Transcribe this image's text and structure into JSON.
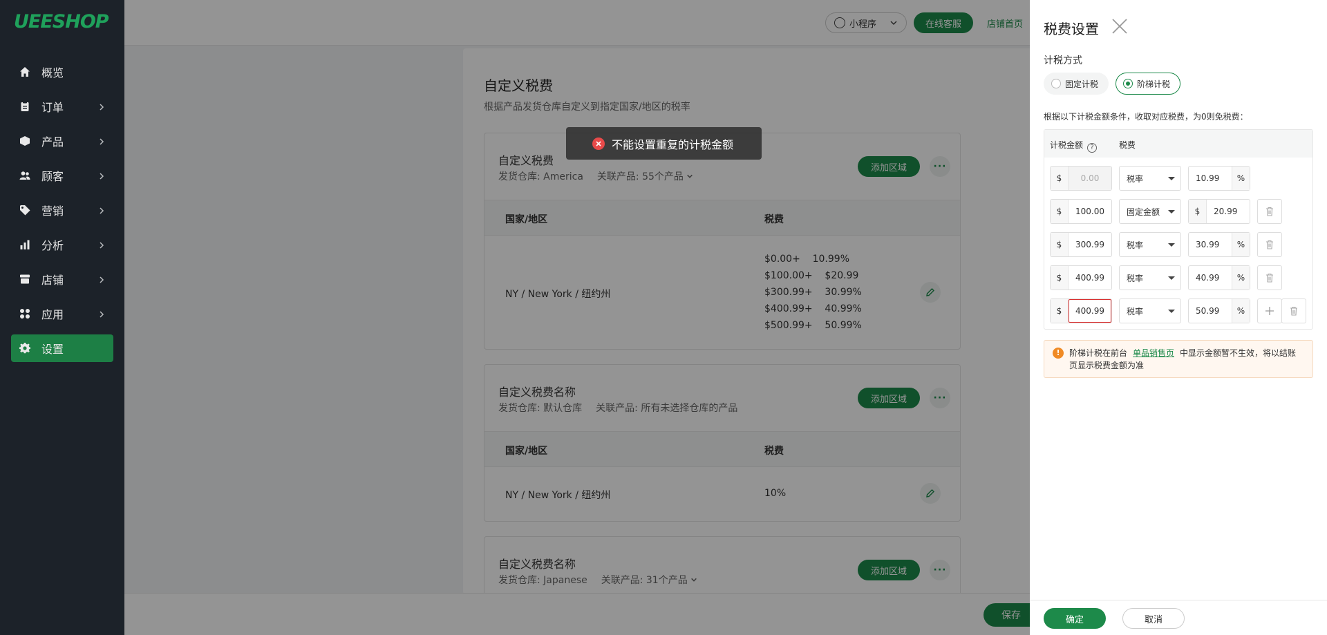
{
  "brand": {
    "logo": "UEESHOP"
  },
  "sidebar": {
    "items": [
      {
        "label": "概览",
        "icon": "home-icon"
      },
      {
        "label": "订单",
        "icon": "clipboard-icon"
      },
      {
        "label": "产品",
        "icon": "box-icon"
      },
      {
        "label": "顾客",
        "icon": "users-icon"
      },
      {
        "label": "营销",
        "icon": "tag-icon"
      },
      {
        "label": "分析",
        "icon": "bar-chart-icon"
      },
      {
        "label": "店铺",
        "icon": "store-icon"
      },
      {
        "label": "应用",
        "icon": "apps-icon"
      },
      {
        "label": "设置",
        "icon": "gear-icon"
      }
    ],
    "active_index": 8
  },
  "topbar": {
    "mini_program": "小程序",
    "service": "在线客服",
    "shop_home": "店铺首页"
  },
  "page": {
    "title": "自定义税费",
    "subtitle": "根据产品发货仓库自定义到指定国家/地区的税率",
    "add_label": "添加"
  },
  "tax_blocks": [
    {
      "title": "自定义税费",
      "warehouse": "发货仓库: America",
      "products": "关联产品: 55个产品",
      "add_region": "添加区域",
      "col_region": "国家/地区",
      "col_tax": "税费",
      "region": "NY / New York / 纽约州",
      "rates": [
        "$0.00+    10.99%",
        "$100.00+    $20.99",
        "$300.99+    30.99%",
        "$400.99+    40.99%",
        "$500.99+    50.99%"
      ]
    },
    {
      "title": "自定义税费名称",
      "warehouse": "发货仓库: 默认仓库",
      "products": "关联产品: 所有未选择仓库的产品",
      "add_region": "添加区域",
      "col_region": "国家/地区",
      "col_tax": "税费",
      "region": "NY / New York / 纽约州",
      "rates": [
        "10%"
      ]
    },
    {
      "title": "自定义税费名称",
      "warehouse": "发货仓库: Japanese",
      "products": "关联产品: 31个产品",
      "add_region": "添加区域"
    }
  ],
  "bottom_bar": {
    "save": "保存"
  },
  "toast": {
    "message": "不能设置重复的计税金额"
  },
  "drawer": {
    "title": "税费设置",
    "method_label": "计税方式",
    "method_options": [
      "固定计税",
      "阶梯计税"
    ],
    "method_selected": "阶梯计税",
    "description": "根据以下计税金额条件，收取对应税费，为0则免税费：",
    "col_amount": "计税金额",
    "col_tax": "税费",
    "currency": "$",
    "percent": "%",
    "tiers": [
      {
        "amount": "0.00",
        "type": "税率",
        "value": "10.99",
        "unit": "%",
        "disabled": true
      },
      {
        "amount": "100.00",
        "type": "固定金额",
        "value": "20.99",
        "unit": "$"
      },
      {
        "amount": "300.99",
        "type": "税率",
        "value": "30.99",
        "unit": "%"
      },
      {
        "amount": "400.99",
        "type": "税率",
        "value": "40.99",
        "unit": "%"
      },
      {
        "amount": "400.99",
        "type": "税率",
        "value": "50.99",
        "unit": "%",
        "error": true
      }
    ],
    "notice": {
      "text_before": "阶梯计税在前台",
      "link": "单品销售页",
      "text_after": "中显示金额暂不生效，将以结账页显示税费金额为准"
    },
    "ok": "确定",
    "cancel": "取消"
  }
}
